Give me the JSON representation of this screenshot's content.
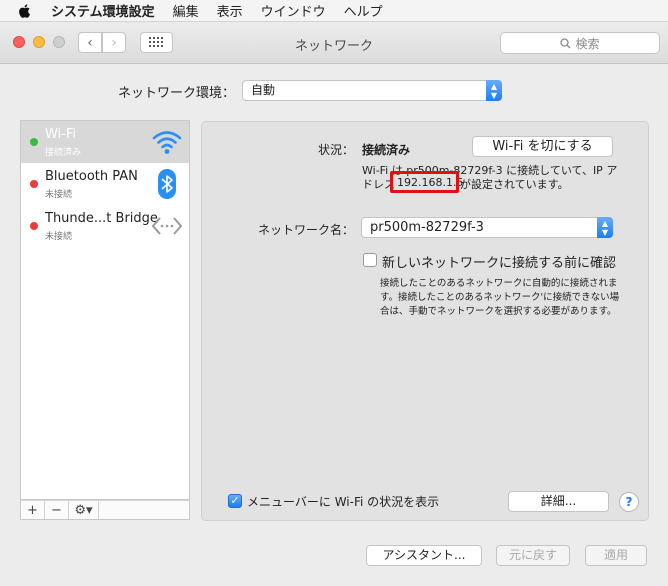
{
  "menubar": {
    "app_name": "システム環境設定",
    "items": [
      "編集",
      "表示",
      "ウインドウ",
      "ヘルプ"
    ]
  },
  "window": {
    "title": "ネットワーク",
    "search_placeholder": "検索"
  },
  "location": {
    "label": "ネットワーク環境：",
    "value": "自動"
  },
  "services": [
    {
      "name": "Wi-Fi",
      "status": "接続済み",
      "status_color": "#3dbb3d",
      "icon": "wifi-icon",
      "selected": true
    },
    {
      "name": "Bluetooth PAN",
      "status": "未接続",
      "status_color": "#ec3b3b",
      "icon": "bluetooth-icon",
      "selected": false
    },
    {
      "name": "Thunde...t Bridge",
      "status": "未接続",
      "status_color": "#ec3b3b",
      "icon": "thunderbolt-bridge-icon",
      "selected": false
    }
  ],
  "sidebar_buttons": {
    "add": "+",
    "remove": "−",
    "action": "⚙▾"
  },
  "detail": {
    "status_label": "状況：",
    "status_value": "接続済み",
    "toggle_wifi": "Wi-Fi を切にする",
    "status_desc_line1": "Wi-Fi は pr500m-82729f-3 に接続していて、IP ア",
    "status_desc_line2_prefix": "ドレス",
    "ip_address": "192.168.1.5",
    "status_desc_line2_suffix": "が設定されています。",
    "network_name_label": "ネットワーク名：",
    "network_name_value": "pr500m-82729f-3",
    "ask_join_label": "新しいネットワークに接続する前に確認",
    "ask_join_checked": false,
    "ask_join_help_lines": [
      "接続したことのあるネットワークに自動的に接続されま",
      "す。接続したことのあるネットワーク'に接続できない場",
      "合は、手動でネットワークを選択する必要があります。"
    ],
    "show_in_menubar_label": "メニューバーに Wi-Fi の状況を表示",
    "show_in_menubar_checked": true,
    "advanced_button": "詳細...",
    "help_button": "?"
  },
  "footer": {
    "assistant": "アシスタント...",
    "revert": "元に戻す",
    "apply": "適用"
  },
  "colors": {
    "accent": "#1c7cf7",
    "highlight": "#e41010"
  }
}
